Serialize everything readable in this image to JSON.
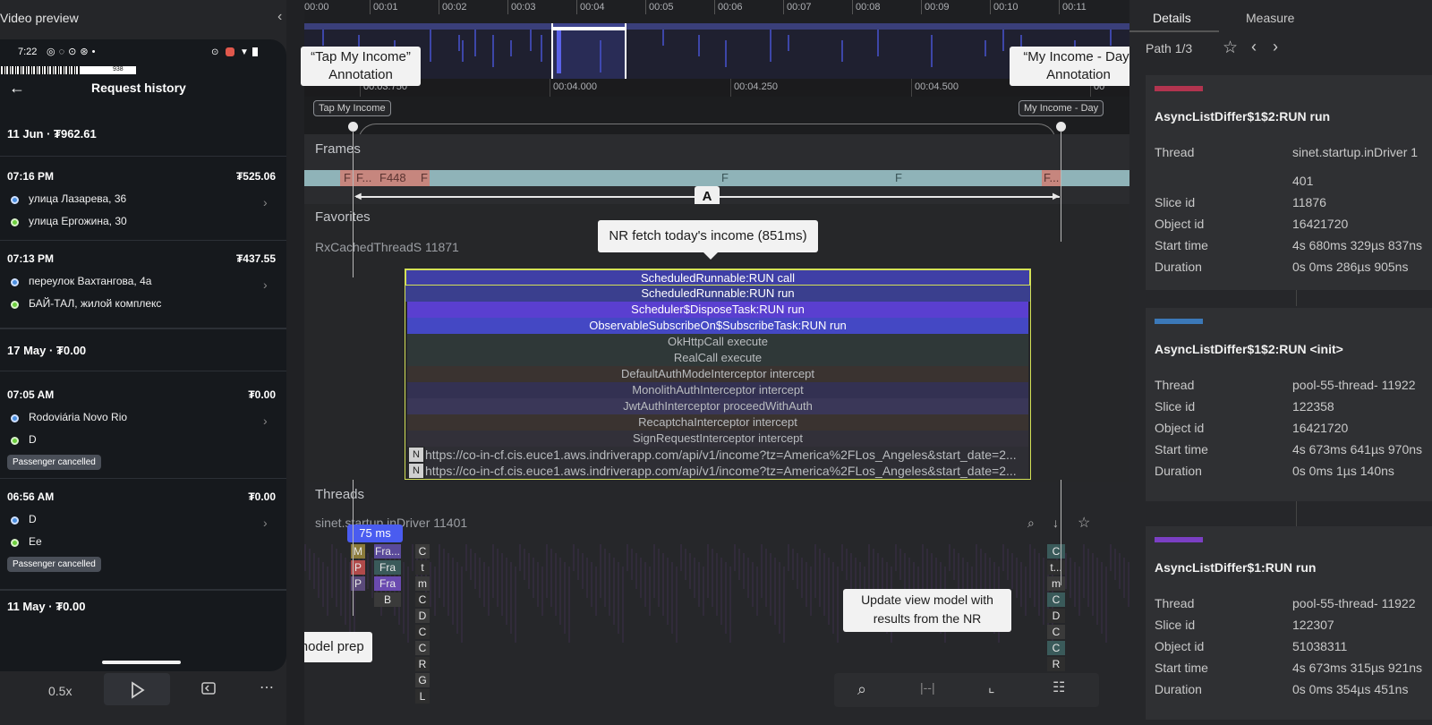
{
  "left_panel": {
    "title": "Video preview",
    "collapse_icon": "chevron-left-icon"
  },
  "phone": {
    "status": {
      "time": "7:22"
    },
    "progress_label": "938",
    "header": {
      "back_icon": "arrow-left-icon",
      "title": "Request history"
    },
    "groups": [
      {
        "date": "11 Jun · ₮962.61"
      },
      {
        "date": "17 May · ₮0.00"
      },
      {
        "date": "11 May · ₮0.00"
      }
    ],
    "rides": [
      {
        "time": "07:16 PM",
        "amount": "₮525.06",
        "from": "улица Лазарева, 36",
        "to": "улица Ергожина, 30"
      },
      {
        "time": "07:13 PM",
        "amount": "₮437.55",
        "from": "переулок Вахтангова, 4а",
        "to": "БАЙ-ТАЛ, жилой комплекс"
      },
      {
        "time": "07:05 AM",
        "amount": "₮0.00",
        "from": "Rodoviária Novo Rio",
        "to": "D",
        "badge": "Passenger cancelled"
      },
      {
        "time": "06:56 AM",
        "amount": "₮0.00",
        "from": "D",
        "to": "Ee",
        "badge": "Passenger cancelled"
      }
    ]
  },
  "playback": {
    "speed": "0.5x",
    "play_icon": "play-icon",
    "replay_icon": "replay-icon",
    "more_icon": "more-icon"
  },
  "timeline": {
    "overview_ticks": [
      "00:00",
      "00:01",
      "00:02",
      "00:03",
      "00:04",
      "00:05",
      "00:06",
      "00:07",
      "00:08",
      "00:09",
      "00:10",
      "00:11"
    ],
    "zoom_ticks": [
      "00:03.750",
      "00:04.000",
      "00:04.250",
      "00:04.500",
      "00"
    ],
    "marker_left": "Tap My Income",
    "marker_right": "My Income - Day",
    "callout_left": "“Tap My Income” Annotation",
    "callout_right": "“My Income - Day” Annotation",
    "sections": {
      "frames": "Frames",
      "favorites": "Favorites",
      "threads": "Threads"
    },
    "frame_labels": [
      "F",
      "F...",
      "F448",
      "F",
      "F",
      "F",
      "F..."
    ],
    "area_label": "A",
    "track_rx": "RxCachedThreadS 11871",
    "track_sinet": "sinet.startup.inDriver 11401",
    "nr_callout": "NR fetch today's income (851ms)",
    "slices": [
      "ScheduledRunnable:RUN call",
      "ScheduledRunnable:RUN run",
      "Scheduler$DisposeTask:RUN run",
      "ObservableSubscribeOn$SubscribeTask:RUN run",
      "OkHttpCall execute",
      "RealCall execute",
      "DefaultAuthModeInterceptor intercept",
      "MonolithAuthInterceptor intercept",
      "JwtAuthInterceptor proceedWithAuth",
      "RecaptchaInterceptor intercept",
      "SignRequestInterceptor intercept",
      "https://co-in-cf.cis.euce1.aws.indriverapp.com/api/v1/income?tz=America%2FLos_Angeles&start_date=2...",
      "https://co-in-cf.cis.euce1.aws.indriverapp.com/api/v1/income?tz=America%2FLos_Angeles&start_date=2..."
    ],
    "n_tag": "N",
    "duration_badge": "75 ms",
    "callout_update": "Update view model with results from the NR",
    "callout_prep": "View model prep",
    "mini_labels_a": [
      "M",
      "P",
      "P"
    ],
    "mini_labels_b": [
      "Fra...",
      "Fra",
      "Fra",
      "B"
    ],
    "mini_labels_c": [
      "C",
      "t",
      "m",
      "C",
      "D",
      "C",
      "C",
      "R",
      "G",
      "L"
    ],
    "mini_labels_d": [
      "C",
      "t...",
      "m",
      "C",
      "D",
      "C",
      "C",
      "R"
    ]
  },
  "details": {
    "tabs": [
      "Details",
      "Measure"
    ],
    "path": "Path 1/3",
    "cards": [
      {
        "color": "#b2344f",
        "title": "AsyncListDiffer$1$2:RUN run",
        "rows": [
          [
            "Thread",
            "sinet.startup.inDriver 1"
          ],
          [
            "",
            "401"
          ],
          [
            "Slice id",
            "11876"
          ],
          [
            "Object id",
            "16421720"
          ],
          [
            "Start time",
            "4s 680ms 329µs 837ns"
          ],
          [
            "Duration",
            "0s 0ms 286µs 905ns"
          ]
        ]
      },
      {
        "color": "#3b78b8",
        "title": "AsyncListDiffer$1$2:RUN <init>",
        "rows": [
          [
            "Thread",
            "pool-55-thread- 11922"
          ],
          [
            "Slice id",
            "122358"
          ],
          [
            "Object id",
            "16421720"
          ],
          [
            "Start time",
            "4s 673ms 641µs 970ns"
          ],
          [
            "Duration",
            "0s 0ms 1µs 140ns"
          ]
        ]
      },
      {
        "color": "#7b3fc4",
        "title": "AsyncListDiffer$1:RUN run",
        "rows": [
          [
            "Thread",
            "pool-55-thread- 11922"
          ],
          [
            "Slice id",
            "122307"
          ],
          [
            "Object id",
            "51038311"
          ],
          [
            "Start time",
            "4s 673ms 315µs 921ns"
          ],
          [
            "Duration",
            "0s 0ms 354µs 451ns"
          ]
        ]
      }
    ]
  }
}
